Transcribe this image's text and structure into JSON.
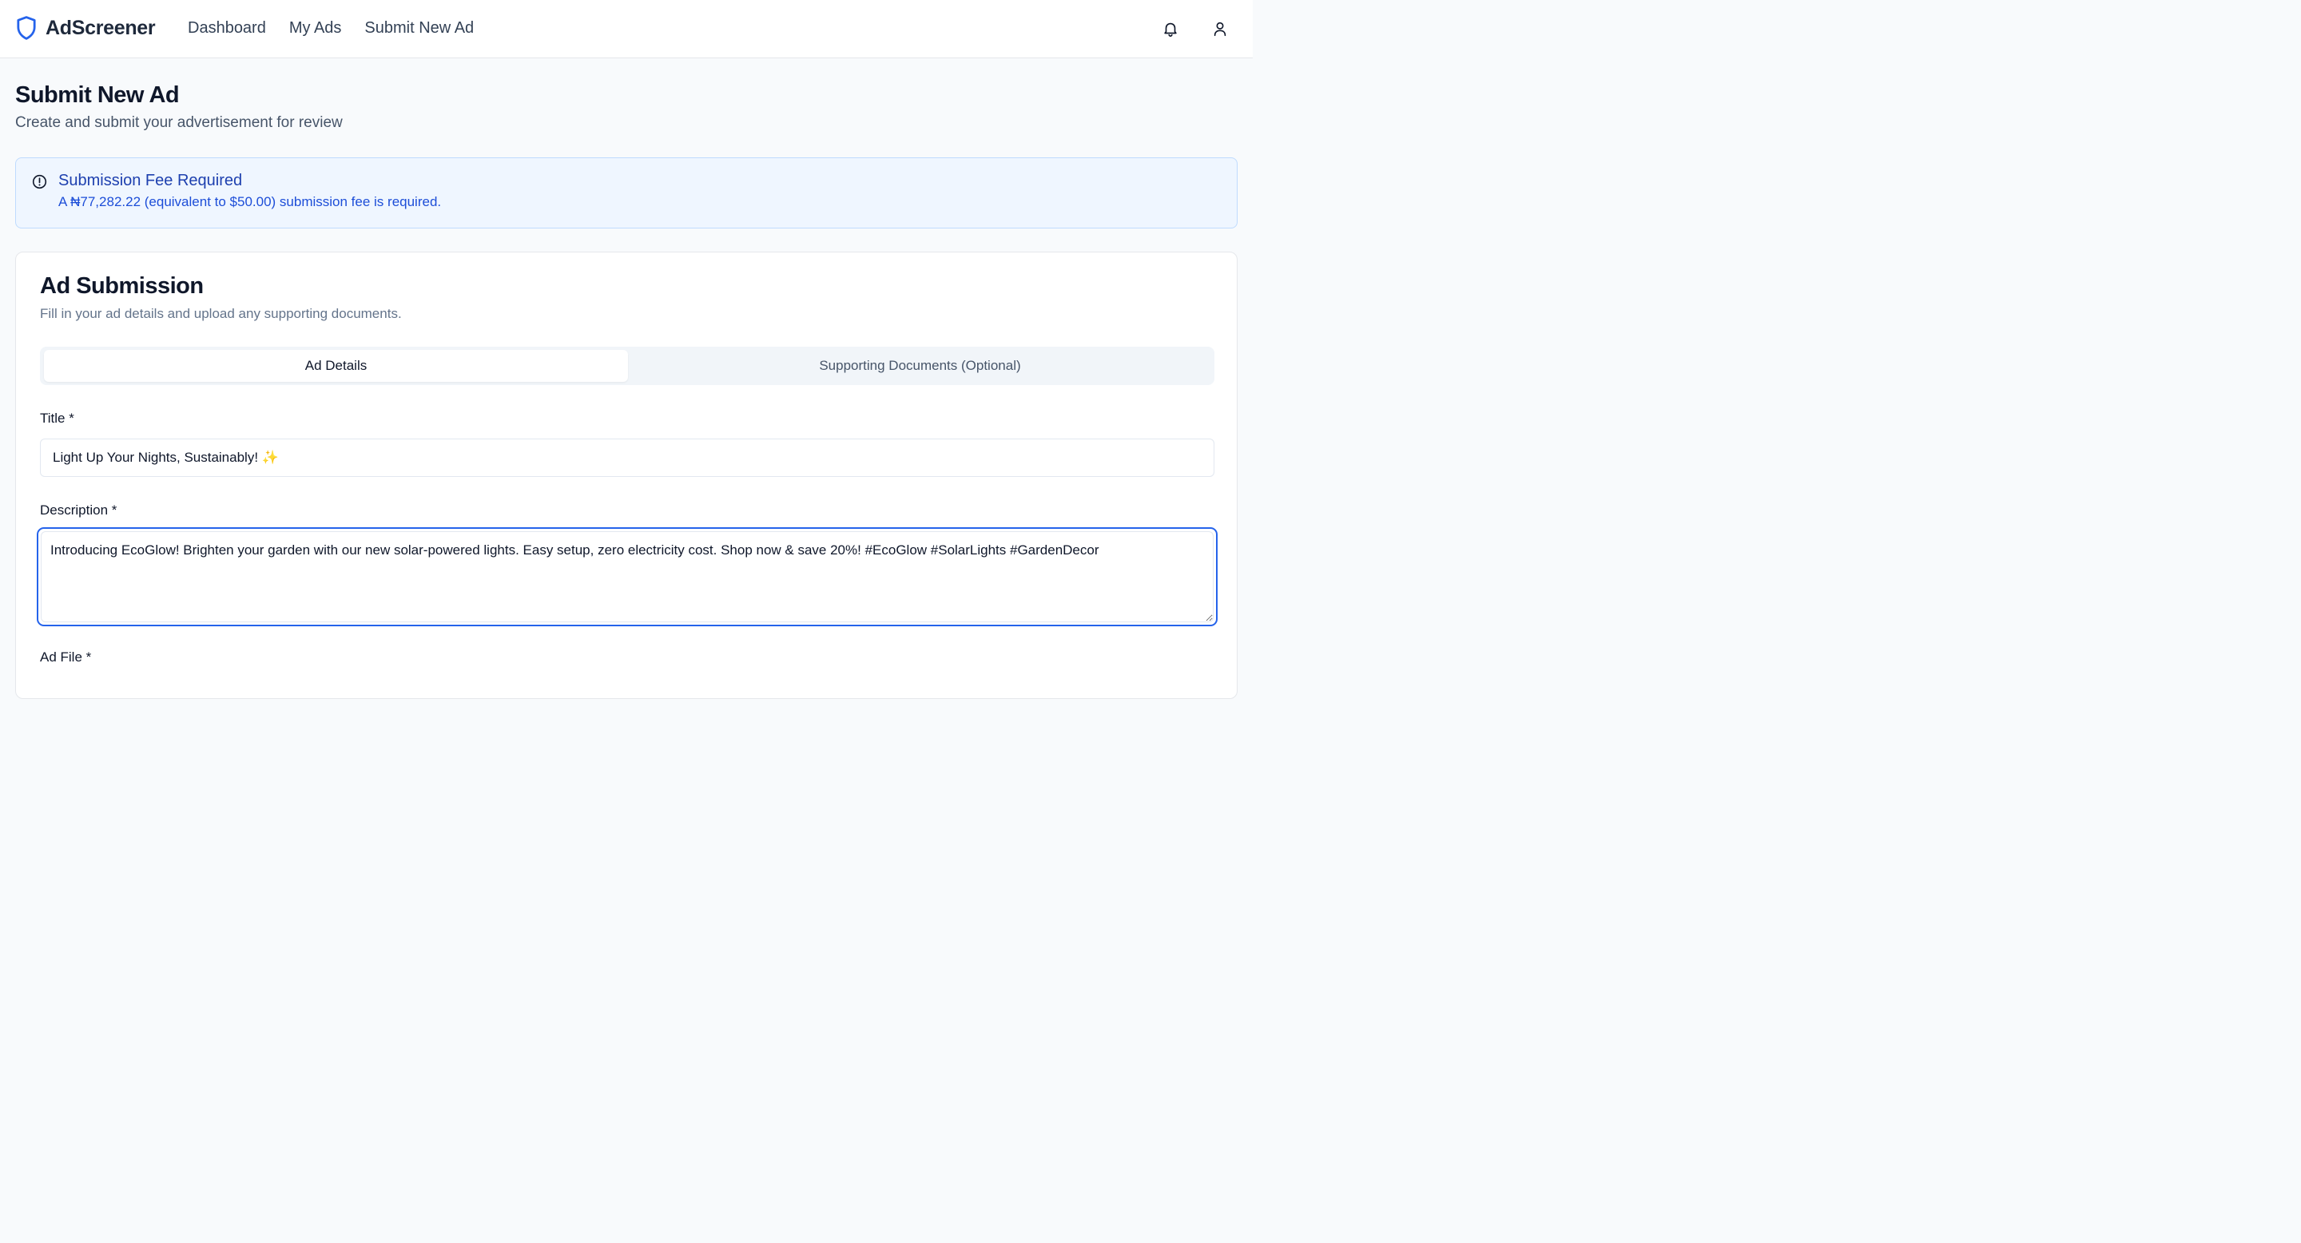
{
  "header": {
    "brand": "AdScreener",
    "nav": [
      "Dashboard",
      "My Ads",
      "Submit New Ad"
    ],
    "icons": [
      "shield-icon",
      "bell-icon",
      "user-icon"
    ],
    "accent_color": "#2563eb"
  },
  "page": {
    "title": "Submit New Ad",
    "subtitle": "Create and submit your advertisement for review"
  },
  "alert": {
    "title": "Submission Fee Required",
    "body": "A ₦77,282.22 (equivalent to $50.00) submission fee is required.",
    "icon": "alert-circle-icon"
  },
  "form": {
    "title": "Ad Submission",
    "subtitle": "Fill in your ad details and upload any supporting documents.",
    "tabs": [
      {
        "label": "Ad Details",
        "active": true
      },
      {
        "label": "Supporting Documents (Optional)",
        "active": false
      }
    ],
    "title_label": "Title *",
    "title_value": "Light Up Your Nights, Sustainably! ✨",
    "description_label": "Description *",
    "description_value": "Introducing EcoGlow! Brighten your garden with our new solar-powered lights. Easy setup, zero electricity cost. Shop now & save 20%! #EcoGlow #SolarLights #GardenDecor",
    "ad_file_label": "Ad File *"
  }
}
